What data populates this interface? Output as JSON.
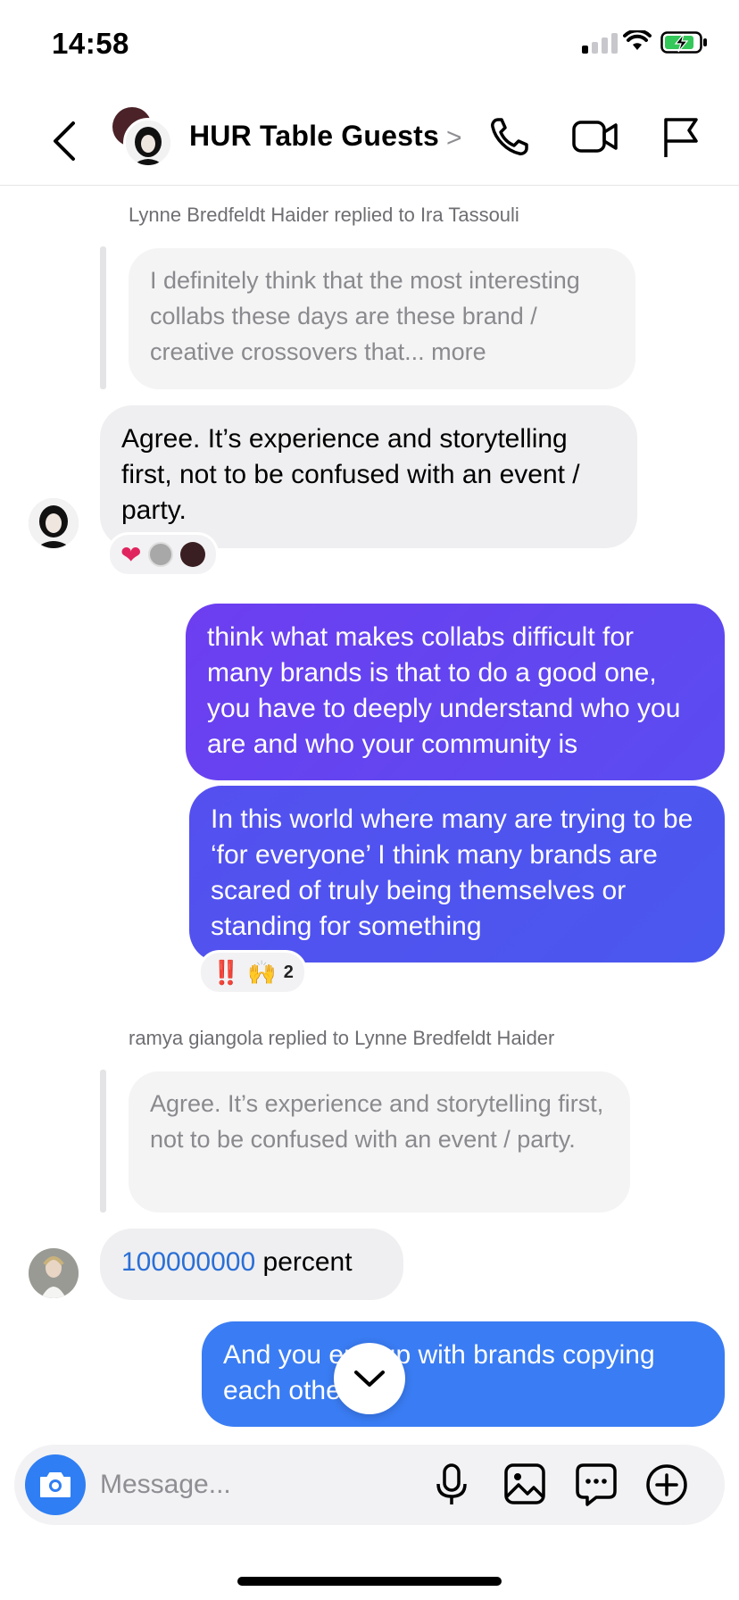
{
  "status_bar": {
    "time": "14:58"
  },
  "header": {
    "title": "HUR Table Guests",
    "chevron": ">"
  },
  "messages": {
    "meta1": "Lynne Bredfeldt Haider replied to Ira Tassouli",
    "quote1": "I definitely think that the most interesting collabs these days are these brand / creative crossovers that... more",
    "msg1": "Agree. It’s experience and storytelling first, not to be confused with an event / party.",
    "msg1_reactions": [
      "heart",
      "grey-avatar",
      "dark-avatar"
    ],
    "msg2": "think what makes collabs difficult for many brands is that to do a good one, you have to deeply understand who you are and who your community is",
    "msg3": "In this world where many are trying to be ‘for everyone’ I think many brands are scared of truly being themselves or standing for something",
    "msg3_reactions": {
      "emoji1": "‼️",
      "emoji2": "🙌",
      "count": "2"
    },
    "meta2": "ramya giangola replied to Lynne Bredfeldt Haider",
    "quote2": "Agree. It’s experience and storytelling first, not to be confused with an event / party.",
    "msg4_number": "100000000",
    "msg4_text": " percent",
    "msg5": "And you end up with brands copying each other"
  },
  "composer": {
    "placeholder": "Message..."
  },
  "colors": {
    "accent": "#2f7ef3",
    "bubble_purple": "#6a40f0",
    "bubble_indigo": "#4a54ef",
    "bubble_blue": "#3a7cf3",
    "incoming_bubble": "#efeff1",
    "link": "#2a6fd6"
  },
  "icons": [
    "back-chevron-icon",
    "phone-icon",
    "video-icon",
    "flag-icon",
    "camera-icon",
    "microphone-icon",
    "gallery-icon",
    "sticker-chat-icon",
    "plus-circle-icon",
    "chevron-down-icon"
  ]
}
